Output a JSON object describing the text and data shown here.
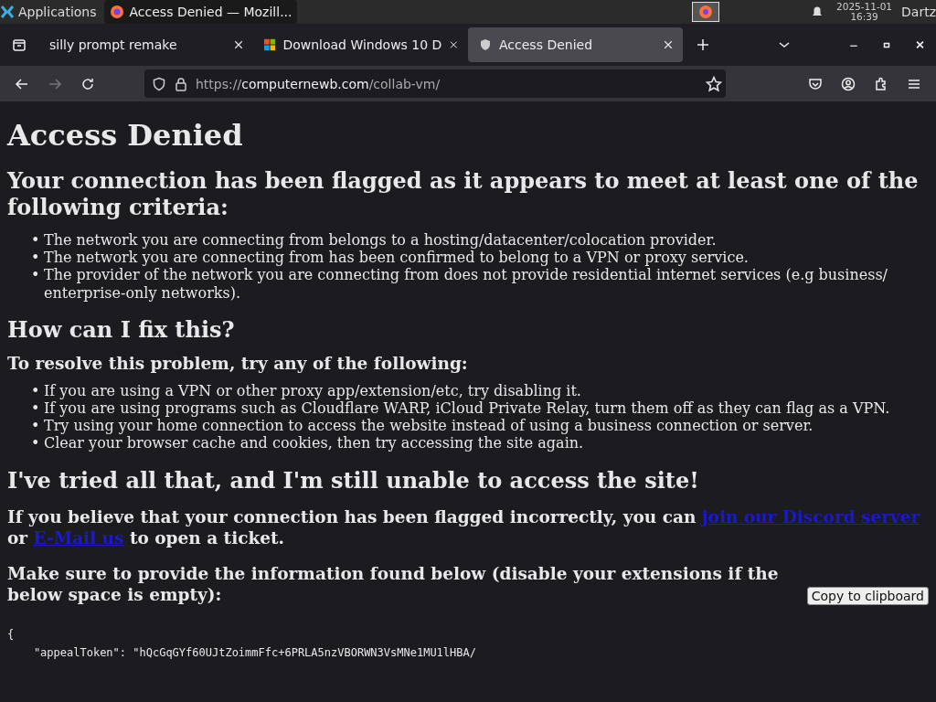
{
  "taskbar": {
    "menu_label": "Applications",
    "window_button": {
      "title": "Access Denied — Mozill...",
      "selected": true
    },
    "date": "2025-11-01",
    "time": "16:39",
    "user": "Dartz"
  },
  "tabs": [
    {
      "title": "silly prompt remake",
      "selected": false,
      "kind": "plain"
    },
    {
      "title": "Download Windows 10 D",
      "selected": false,
      "kind": "windows"
    },
    {
      "title": "Access Denied",
      "selected": true,
      "kind": "shield"
    }
  ],
  "url": {
    "scheme": "https://",
    "host": "computernewb.com",
    "path": "/collab-vm/"
  },
  "page": {
    "title": "Access Denied",
    "intro_heading": "Your connection has been flagged as it appears to meet at least one of the following criteria:",
    "bullet": "•",
    "criteria": [
      "The network you are connecting from belongs to a hosting/datacenter/colocation provider.",
      "The network you are connecting from has been confirmed to belong to a VPN or proxy service.",
      "The provider of the network you are connecting from does not provide residential internet services (e.g business/ enterprise-only networks)."
    ],
    "fix_heading": "How can I fix this?",
    "fix_subheading": "To resolve this problem, try any of the following:",
    "steps": [
      "If you are using a VPN or other proxy app/extension/etc, try disabling it.",
      "If you are using programs such as Cloudflare WARP, iCloud Private Relay, turn them off as they can flag as a VPN.",
      "Try using your home connection to access the website instead of using a business connection or server.",
      "Clear your browser cache and cookies, then try accessing the site again."
    ],
    "still_heading": "I've tried all that, and I'm still unable to access the site!",
    "contact": [
      {
        "kind": "text",
        "text": "If you believe that your connection has been flagged incorrectly, you can "
      },
      {
        "kind": "link",
        "text": "join our Discord server"
      },
      {
        "kind": "text",
        "text": " or "
      },
      {
        "kind": "link",
        "text": "E-Mail us"
      },
      {
        "kind": "text",
        "text": " to open a ticket."
      }
    ],
    "info_text": "Make sure to provide the information found below (disable your extensions if the below space is empty):",
    "copy_button": "Copy to clipboard",
    "code_lines": [
      "{",
      "    \"appealToken\": \"hQcGqGYf60UJtZoimmFfc+6PRLA5nzVBORWN3VsMNe1MU1lHBA/"
    ]
  }
}
